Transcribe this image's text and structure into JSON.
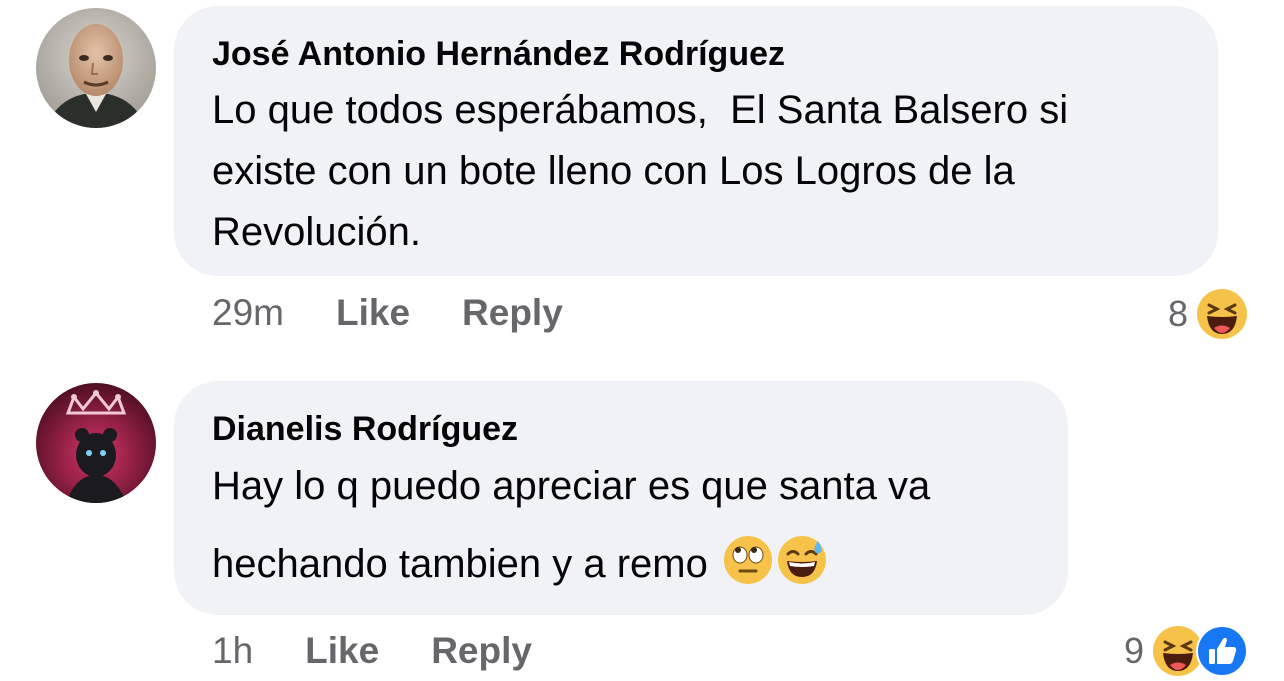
{
  "comments": [
    {
      "author": "José Antonio Hernández Rodríguez",
      "text": "Lo que todos esperábamos,  El Santa Balsero si existe con un bote lleno con Los Logros de la Revolución.",
      "time": "29m",
      "like_label": "Like",
      "reply_label": "Reply",
      "reaction_count": "8",
      "reactions": [
        "haha-reaction-icon"
      ]
    },
    {
      "author": "Dianelis Rodríguez",
      "text_line1": "Hay lo q puedo apreciar es que santa va",
      "text_line2": "hechando tambien y a remo",
      "inline_emojis": [
        "eye-roll-emoji-icon",
        "sweat-smile-emoji-icon"
      ],
      "time": "1h",
      "like_label": "Like",
      "reply_label": "Reply",
      "reaction_count": "9",
      "reactions": [
        "haha-reaction-icon",
        "like-reaction-icon"
      ]
    }
  ],
  "colors": {
    "bubble": "#f0f2f5",
    "secondary_text": "#65676b",
    "primary_text": "#050505",
    "like_blue": "#1877f2",
    "haha_yellow": "#f7c24a"
  }
}
